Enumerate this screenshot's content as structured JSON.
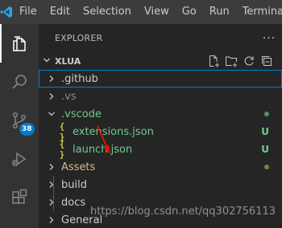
{
  "menu": [
    "File",
    "Edit",
    "Selection",
    "View",
    "Go",
    "Run",
    "Terminal"
  ],
  "explorer": {
    "title": "EXPLORER",
    "more": "···",
    "section_title": "XLUA"
  },
  "activity": {
    "scm_badge": "38"
  },
  "colors": {
    "accent": "#007acc",
    "modified_green": "#73c991",
    "untracked_olive": "#a8a135",
    "arrow_red": "#e51400"
  },
  "tree": [
    {
      "label": ".github",
      "type": "folder",
      "expanded": false,
      "color": "#cccccc",
      "decoration": ""
    },
    {
      "label": ".vs",
      "type": "folder",
      "expanded": false,
      "color": "#8c8c8c",
      "decoration": ""
    },
    {
      "label": ".vscode",
      "type": "folder",
      "expanded": true,
      "color": "#73c991",
      "decoration": "dot"
    },
    {
      "label": "extensions.json",
      "type": "json",
      "icon": "{ }",
      "color": "#73c991",
      "decoration": "U"
    },
    {
      "label": "launch.json",
      "type": "json",
      "icon": "{ }",
      "color": "#73c991",
      "decoration": "U"
    },
    {
      "label": "Assets",
      "type": "folder",
      "expanded": false,
      "color": "#d7ba7d",
      "decoration": "dot"
    },
    {
      "label": "build",
      "type": "folder",
      "expanded": false,
      "color": "#cccccc",
      "decoration": ""
    },
    {
      "label": "docs",
      "type": "folder",
      "expanded": false,
      "color": "#cccccc",
      "decoration": ""
    },
    {
      "label": "General",
      "type": "folder",
      "expanded": false,
      "color": "#cccccc",
      "decoration": ""
    }
  ],
  "watermark": "https://blog.csdn.net/qq302756113"
}
